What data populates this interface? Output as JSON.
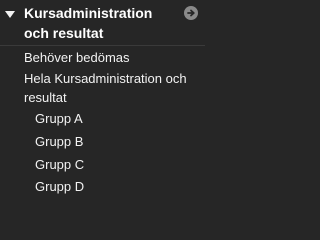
{
  "panel": {
    "header_title": "Kursadministration och resultat",
    "items": [
      {
        "label": "Behöver bedömas"
      },
      {
        "label": "Hela Kursadministration och resultat"
      },
      {
        "label": "Grupp A"
      },
      {
        "label": "Grupp B"
      },
      {
        "label": "Grupp C"
      },
      {
        "label": "Grupp D"
      }
    ]
  },
  "colors": {
    "background": "#262626",
    "text": "#f2f2f2",
    "icon": "#8a8a8a"
  },
  "icons": {
    "collapse": "caret-down-icon",
    "go": "arrow-circle-right-icon"
  }
}
